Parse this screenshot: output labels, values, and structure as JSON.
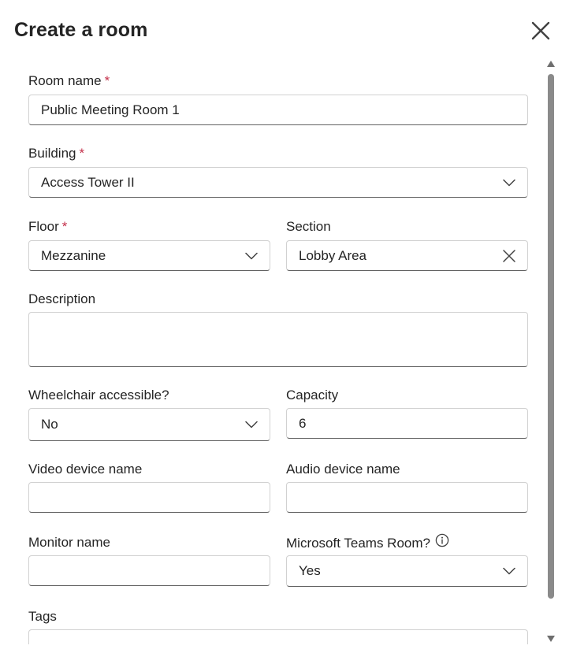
{
  "dialog": {
    "title": "Create a room",
    "close_label": "close"
  },
  "form": {
    "room_name": {
      "label": "Room name",
      "required": "*",
      "value": "Public Meeting Room 1"
    },
    "building": {
      "label": "Building",
      "required": "*",
      "value": "Access Tower II"
    },
    "floor": {
      "label": "Floor",
      "required": "*",
      "value": "Mezzanine"
    },
    "section": {
      "label": "Section",
      "value": "Lobby Area"
    },
    "description": {
      "label": "Description",
      "value": ""
    },
    "wheelchair": {
      "label": "Wheelchair accessible?",
      "value": "No"
    },
    "capacity": {
      "label": "Capacity",
      "value": "6"
    },
    "video_device": {
      "label": "Video device name",
      "value": ""
    },
    "audio_device": {
      "label": "Audio device name",
      "value": ""
    },
    "monitor": {
      "label": "Monitor name",
      "value": ""
    },
    "teams_room": {
      "label": "Microsoft Teams Room?",
      "value": "Yes"
    },
    "tags": {
      "label": "Tags",
      "value": ""
    }
  },
  "icons": {
    "close": "close-icon",
    "chevron": "chevron-down-icon",
    "clear": "clear-icon",
    "info": "info-icon",
    "scroll_up": "scroll-up-arrow-icon",
    "scroll_down": "scroll-down-arrow-icon"
  },
  "colors": {
    "required_asterisk": "#c4314b",
    "text": "#242424",
    "border": "#d1d1d1",
    "scroll_thumb": "#8a8a8a"
  }
}
